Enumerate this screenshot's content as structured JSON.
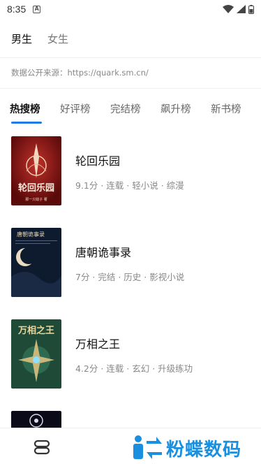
{
  "status_bar": {
    "time": "8:35"
  },
  "gender_tabs": [
    "男生",
    "女生"
  ],
  "source_text": "数据公开来源：https://quark.sm.cn/",
  "rank_tabs": [
    "热搜榜",
    "好评榜",
    "完结榜",
    "飙升榜",
    "新书榜"
  ],
  "books": [
    {
      "title": "轮回乐园",
      "meta": "9.1分 · 连载 · 轻小说 · 综漫"
    },
    {
      "title": "唐朝诡事录",
      "meta": "7分 · 完结 · 历史 · 影视小说"
    },
    {
      "title": "万相之王",
      "meta": "4.2分 · 连载 · 玄幻 · 升级练功"
    }
  ],
  "watermark": "粉蝶数码",
  "colors": {
    "accent": "#1e7be8",
    "watermark": "#1a8fe0"
  }
}
